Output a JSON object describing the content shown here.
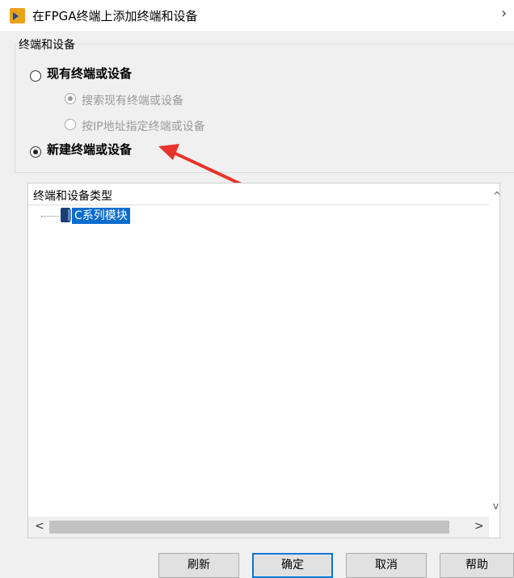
{
  "window": {
    "title": "在FPGA终端上添加终端和设备",
    "close_symbol": "›"
  },
  "group": {
    "title": "终端和设备",
    "existing_option": "现有终端或设备",
    "search_option": "搜索现有终端或设备",
    "ip_option": "按IP地址指定终端或设备",
    "new_option": "新建终端或设备"
  },
  "tree": {
    "header": "终端和设备类型",
    "items": [
      {
        "label": "C系列模块"
      }
    ]
  },
  "buttons": {
    "refresh": "刷新",
    "ok": "确定",
    "cancel": "取消",
    "help": "帮助"
  },
  "scroll": {
    "up": "^",
    "down": "v",
    "left": "<",
    "right": ">"
  },
  "colors": {
    "selection": "#0a6ccf",
    "arrow": "#e8332a",
    "primary_border": "#0078d7"
  }
}
